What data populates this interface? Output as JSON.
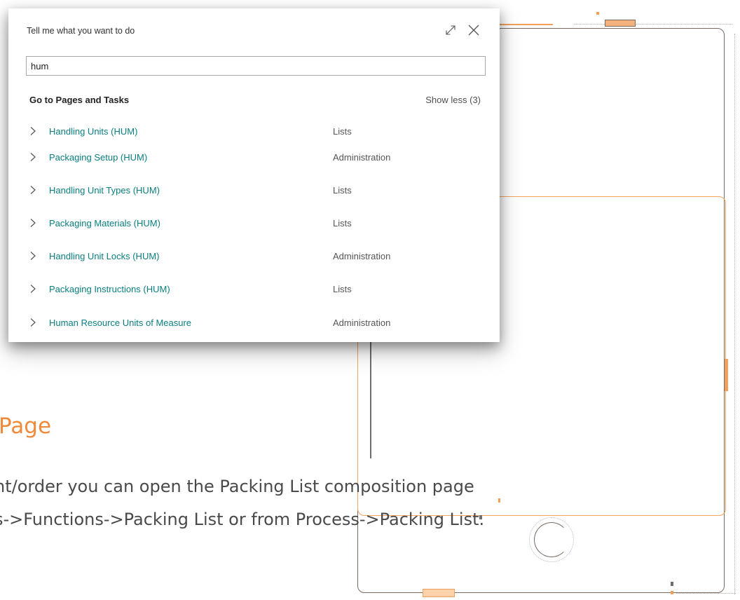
{
  "slide": {
    "heading": "Page",
    "body_line1": "nt/order you can open the Packing List composition page",
    "body_line2": "s->Functions->Packing List or from Process->Packing List."
  },
  "dialog": {
    "title": "Tell me what you want to do",
    "search_value": "hum",
    "section_title": "Go to Pages and Tasks",
    "show_less_label": "Show less (3)",
    "icons": {
      "expand": "expand-icon",
      "close": "close-icon",
      "row": "chevron-right-icon"
    },
    "results": [
      {
        "name": "Handling Units (HUM)",
        "category": "Lists"
      },
      {
        "name": "Packaging Setup (HUM)",
        "category": "Administration"
      },
      {
        "name": "Handling Unit Types (HUM)",
        "category": "Lists"
      },
      {
        "name": "Packaging Materials (HUM)",
        "category": "Lists"
      },
      {
        "name": "Handling Unit Locks (HUM)",
        "category": "Administration"
      },
      {
        "name": "Packaging Instructions (HUM)",
        "category": "Lists"
      },
      {
        "name": "Human Resource Units of Measure",
        "category": "Administration"
      }
    ]
  },
  "colors": {
    "link": "#0a7e80",
    "accent_orange": "#ee8a3a",
    "frame_grey": "#7a6a60"
  }
}
